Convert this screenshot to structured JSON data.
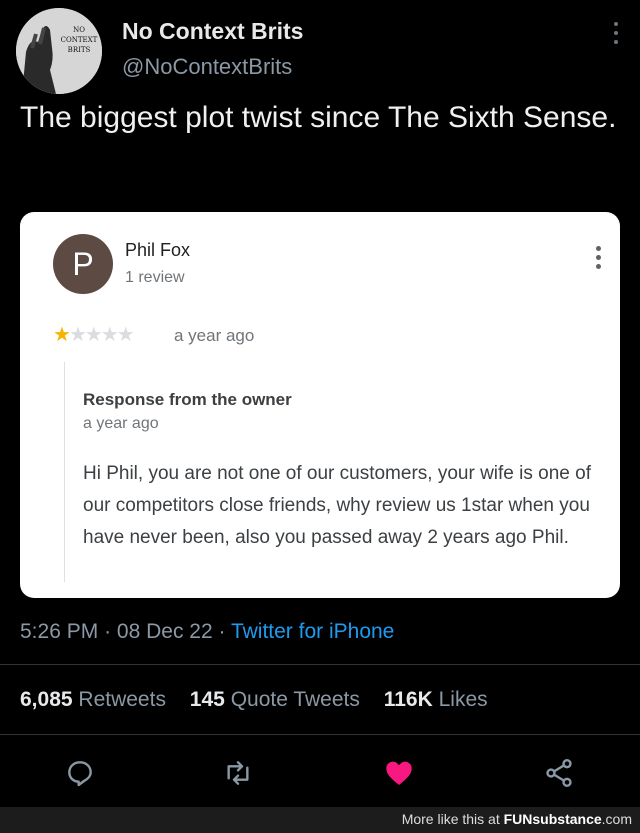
{
  "tweet": {
    "author_name": "No Context Brits",
    "author_handle": "@NoContextBrits",
    "avatar_text": [
      "NO",
      "CONTEXT",
      "BRITS"
    ],
    "text": "The biggest plot twist since The Sixth Sense.",
    "time": "5:26 PM",
    "date": "08 Dec 22",
    "source": "Twitter for iPhone",
    "separator": "·"
  },
  "review": {
    "avatar_letter": "P",
    "reviewer_name": "Phil Fox",
    "review_count": "1 review",
    "rating": 1,
    "rating_max": 5,
    "star_glyph": "★",
    "time": "a year ago",
    "response_title": "Response from the owner",
    "response_time": "a year ago",
    "response_text": "Hi Phil, you are not one of our customers, your wife is one of our competitors close friends, why review us 1star when you have never been, also you passed away 2 years ago Phil."
  },
  "stats": {
    "retweets_count": "6,085",
    "retweets_label": "Retweets",
    "quotes_count": "145",
    "quotes_label": "Quote Tweets",
    "likes_count": "116K",
    "likes_label": "Likes"
  },
  "actions": [
    "reply-icon",
    "retweet-icon",
    "like-icon",
    "share-icon"
  ],
  "footer": {
    "prefix": "More like this at ",
    "brand": "FUNsubstance",
    "suffix": ".com"
  },
  "colors": {
    "background": "#000000",
    "accent": "#1d9bf0",
    "like": "#f91880",
    "star": "#f5b400",
    "review_avatar": "#5d4a43"
  }
}
